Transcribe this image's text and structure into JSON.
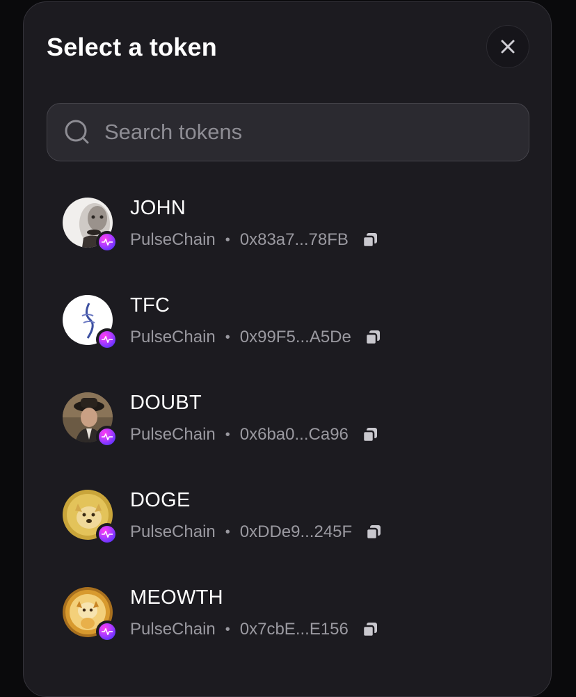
{
  "modal": {
    "title": "Select a token",
    "close_icon": "close-icon"
  },
  "search": {
    "placeholder": "Search tokens",
    "value": "",
    "icon": "search-icon"
  },
  "colors": {
    "background": "#0a0a0c",
    "modal_bg": "#1c1b20",
    "search_bg": "#2b2a30",
    "text_primary": "#ffffff",
    "text_secondary": "#9a99a0",
    "pulsechain_badge": "#b63bff"
  },
  "tokens": [
    {
      "symbol": "JOHN",
      "chain": "PulseChain",
      "address": "0x83a7...78FB",
      "avatar_color": "#e8e6e4",
      "copy_icon": "copy-icon"
    },
    {
      "symbol": "TFC",
      "chain": "PulseChain",
      "address": "0x99F5...A5De",
      "avatar_color": "#ffffff",
      "copy_icon": "copy-icon"
    },
    {
      "symbol": "DOUBT",
      "chain": "PulseChain",
      "address": "0x6ba0...Ca96",
      "avatar_color": "#5a4a3a",
      "copy_icon": "copy-icon"
    },
    {
      "symbol": "DOGE",
      "chain": "PulseChain",
      "address": "0xDDe9...245F",
      "avatar_color": "#e7c552",
      "copy_icon": "copy-icon"
    },
    {
      "symbol": "MEOWTH",
      "chain": "PulseChain",
      "address": "0x7cbE...E156",
      "avatar_color": "#e9b94a",
      "copy_icon": "copy-icon"
    }
  ],
  "separator": "•"
}
